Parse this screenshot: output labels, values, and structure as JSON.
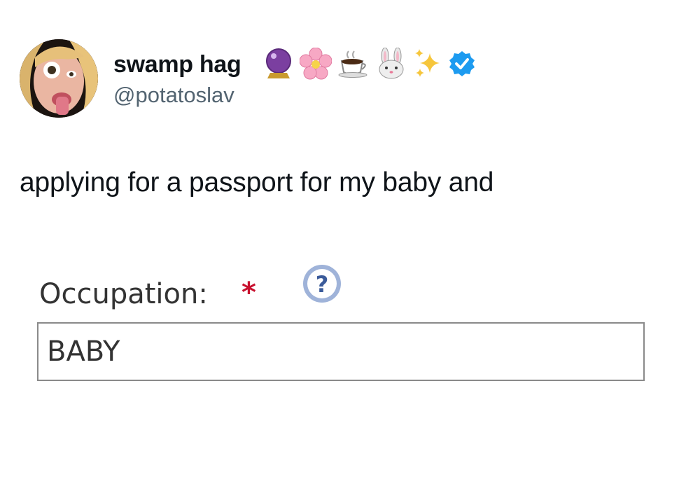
{
  "tweet": {
    "author": {
      "display_name": "swamp hag",
      "handle": "@potatoslav",
      "name_emojis": [
        "crystal-ball",
        "cherry-blossom",
        "hot-beverage",
        "rabbit-face",
        "sparkles"
      ],
      "verified": true
    },
    "text": "applying for a passport for my baby and"
  },
  "form": {
    "field_label": "Occupation:",
    "required_mark": "*",
    "help_symbol": "?",
    "field_value": "BABY"
  },
  "colors": {
    "verified_badge": "#1d9bf0",
    "required_star": "#c8102e",
    "help_icon": "#3b5b9a",
    "handle_text": "#536471"
  }
}
